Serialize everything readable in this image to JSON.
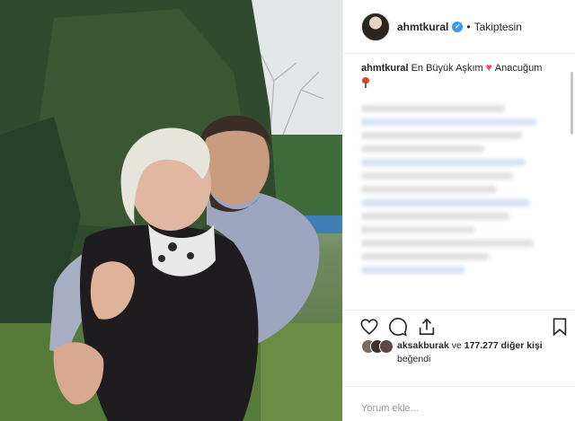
{
  "post": {
    "photo_alt": "photo",
    "username": "ahmtkural",
    "separator": "•",
    "follow_status": "Takiptesin",
    "caption": {
      "username": "ahmtkural",
      "text_before_heart": "En Büyük Aşkım",
      "text_after_heart": "Anacuğum"
    }
  },
  "likes": {
    "user": "aksakburak",
    "middle": " ve ",
    "count_text": "177.277 diğer kişi",
    "suffix": "beğendi"
  },
  "comment": {
    "placeholder": "Yorum ekle..."
  },
  "colors": {
    "accent": "#3897f0",
    "heart": "#ed4956",
    "text": "#262626",
    "muted": "#999999",
    "border": "#efefef"
  }
}
